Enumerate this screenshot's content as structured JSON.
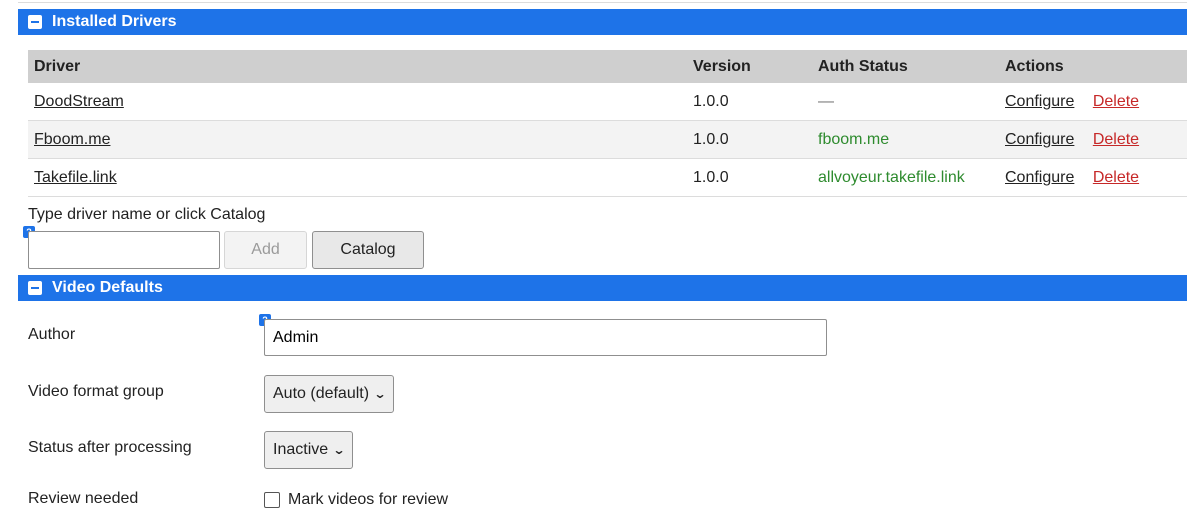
{
  "installed_drivers": {
    "title": "Installed Drivers",
    "columns": {
      "driver": "Driver",
      "version": "Version",
      "auth_status": "Auth Status",
      "actions": "Actions"
    },
    "rows": [
      {
        "driver": "DoodStream",
        "version": "1.0.0",
        "auth_status": "—",
        "configure": "Configure",
        "delete": "Delete"
      },
      {
        "driver": "Fboom.me",
        "version": "1.0.0",
        "auth_status": "fboom.me",
        "configure": "Configure",
        "delete": "Delete"
      },
      {
        "driver": "Takefile.link",
        "version": "1.0.0",
        "auth_status": "allvoyeur.takefile.link",
        "configure": "Configure",
        "delete": "Delete"
      }
    ],
    "add_hint": "Type driver name or click Catalog",
    "add_input_value": "",
    "add_button": "Add",
    "catalog_button": "Catalog",
    "help_icon": "?"
  },
  "video_defaults": {
    "title": "Video Defaults",
    "author_label": "Author",
    "author_value": "Admin",
    "help_icon": "?",
    "format_group_label": "Video format group",
    "format_group_value": "Auto (default)",
    "status_label": "Status after processing",
    "status_value": "Inactive",
    "review_label": "Review needed",
    "review_checkbox_label": "Mark videos for review",
    "review_checked": false
  },
  "colors": {
    "section_header": "#1e73e8",
    "delete_link": "#c62828",
    "auth_ok": "#2e8b2e",
    "table_header": "#cfcfcf"
  }
}
